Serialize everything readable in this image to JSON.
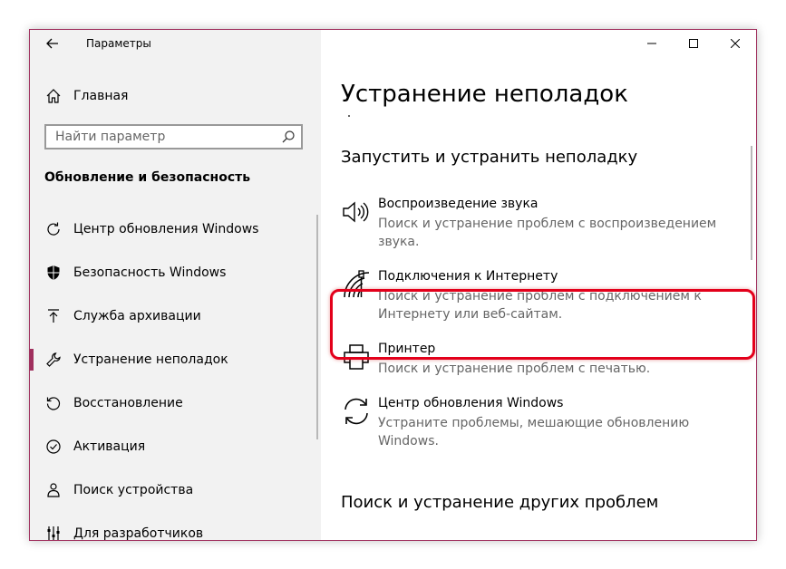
{
  "window": {
    "title": "Параметры",
    "accent": "#a0305e",
    "highlight_color": "#e3001b"
  },
  "titlebar": {
    "back_icon": "back-arrow-icon",
    "minimize_icon": "minimize-icon",
    "maximize_icon": "maximize-icon",
    "close_icon": "close-icon"
  },
  "sidebar": {
    "home_label": "Главная",
    "search_placeholder": "Найти параметр",
    "section_title": "Обновление и безопасность",
    "items": [
      {
        "label": "Центр обновления Windows",
        "icon": "refresh-icon",
        "active": false
      },
      {
        "label": "Безопасность Windows",
        "icon": "shield-icon",
        "active": false
      },
      {
        "label": "Служба архивации",
        "icon": "upload-icon",
        "active": false
      },
      {
        "label": "Устранение неполадок",
        "icon": "wrench-icon",
        "active": true
      },
      {
        "label": "Восстановление",
        "icon": "restore-icon",
        "active": false
      },
      {
        "label": "Активация",
        "icon": "check-circle-icon",
        "active": false
      },
      {
        "label": "Поиск устройства",
        "icon": "person-pin-icon",
        "active": false
      },
      {
        "label": "Для разработчиков",
        "icon": "developer-icon",
        "active": false
      }
    ]
  },
  "main": {
    "page_title": "Устранение неполадок",
    "section1_title": "Запустить и устранить неполадку",
    "section2_title": "Поиск и устранение других проблем",
    "items": [
      {
        "title": "Воспроизведение звука",
        "desc": "Поиск и устранение проблем с воспроизведением звука.",
        "icon": "speaker-icon"
      },
      {
        "title": "Подключения к Интернету",
        "desc": "Поиск и устранение проблем с подключением к Интернету или веб-сайтам.",
        "icon": "network-icon"
      },
      {
        "title": "Принтер",
        "desc": "Поиск и устранение проблем с печатью.",
        "icon": "printer-icon"
      },
      {
        "title": "Центр обновления Windows",
        "desc": "Устраните проблемы, мешающие обновлению Windows.",
        "icon": "sync-icon"
      }
    ]
  }
}
